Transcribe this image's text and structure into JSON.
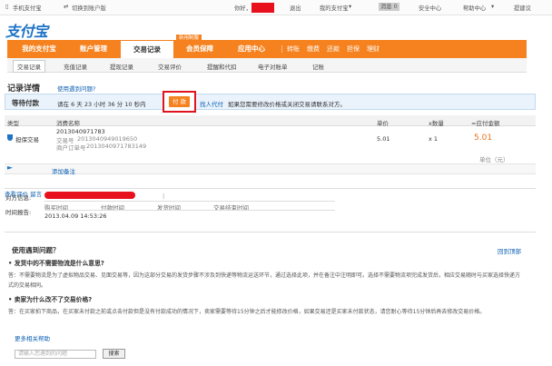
{
  "topbar": {
    "phone_alipay": "手机支付宝",
    "switch_account": "切换到账户版",
    "greeting": "你好，",
    "logout": "退出",
    "my_alipay": "我的支付宝",
    "message": "消息",
    "message_count": "0",
    "security_center": "安全中心",
    "help_center": "帮助中心",
    "suggestion": "提建议"
  },
  "logo": "支付宝",
  "nav": {
    "tabs": [
      "我的支付宝",
      "账户管理",
      "交易记录",
      "会员保障",
      "应用中心"
    ],
    "badge": "新用制服",
    "quick": [
      "转账",
      "缴费",
      "还款",
      "担保",
      "理财"
    ]
  },
  "subnav": [
    "交易记录",
    "充值记录",
    "提现记录",
    "交易评价",
    "提醒和代扣",
    "电子对账单",
    "记账"
  ],
  "title": "记录详情",
  "title_link": "使用遇到问题?",
  "wait": {
    "label": "等待付款",
    "prefix": "请在",
    "days": "6",
    "days_unit": "天",
    "hours": "23",
    "hours_unit": "小时",
    "minutes": "36",
    "minutes_unit": "分",
    "seconds": "10",
    "seconds_unit": "秒内",
    "pay_button": "付 款",
    "proxy_pay": "找人代付",
    "suffix": "如果您需要修改价格或关闭交易请联系对方。"
  },
  "table": {
    "headers": [
      "类型",
      "消费名称",
      "单价",
      "x数量",
      "=应付金额"
    ],
    "type": "担保交易",
    "name": "2013040971783",
    "trade_no_label": "交易号",
    "trade_no": "2013040949019650",
    "order_no_label": "商户订单号",
    "order_no": "2013040971783149",
    "price": "5.01",
    "qty": "x 1",
    "total": "5.01"
  },
  "unit_label": "单位（元）",
  "add_note": "添加备注",
  "info": {
    "counterpart_label": "对方信息:",
    "view_review": "查看评价",
    "message_link": "留言",
    "time_label": "时间报告:",
    "cols": [
      "购买时间",
      "付款时间",
      "发货时间",
      "交易结束时间"
    ],
    "buy_time": "2013.04.09 14:53:26"
  },
  "faq": {
    "heading": "使用遇到问题？",
    "back_top": "回到顶部",
    "q1": "• 发货中的不需要物流是什么意思?",
    "a1": "答：不需要物流是为了虚拟物品交易、见面交易等，因为这部分交易的发货步骤不涉及到快递等物流运送环节，通过选择此项，并在备注中注明即可。选择不需要物流项完成发货后，相应交易随时与买家选择快递方式的交易相同。",
    "q2": "• 卖家为什么改不了交易价格?",
    "a2": "答：在买家拍下商品，在买家未付款之前或点击付款但是没有付款成功的情况下，卖家需要等待15分钟之后才能修改价格，如果交易还是买家未付款状态，请您耐心等待15分钟后再去修改交易价格。",
    "more_help": "更多相关帮助",
    "search_placeholder": "请输入您遇到的问题",
    "search_button": "搜索"
  },
  "colors": {
    "brand_orange": "#f5821f",
    "link_blue": "#0a5fb4",
    "highlight_red": "#e0141c",
    "amount_orange": "#e9731b"
  }
}
